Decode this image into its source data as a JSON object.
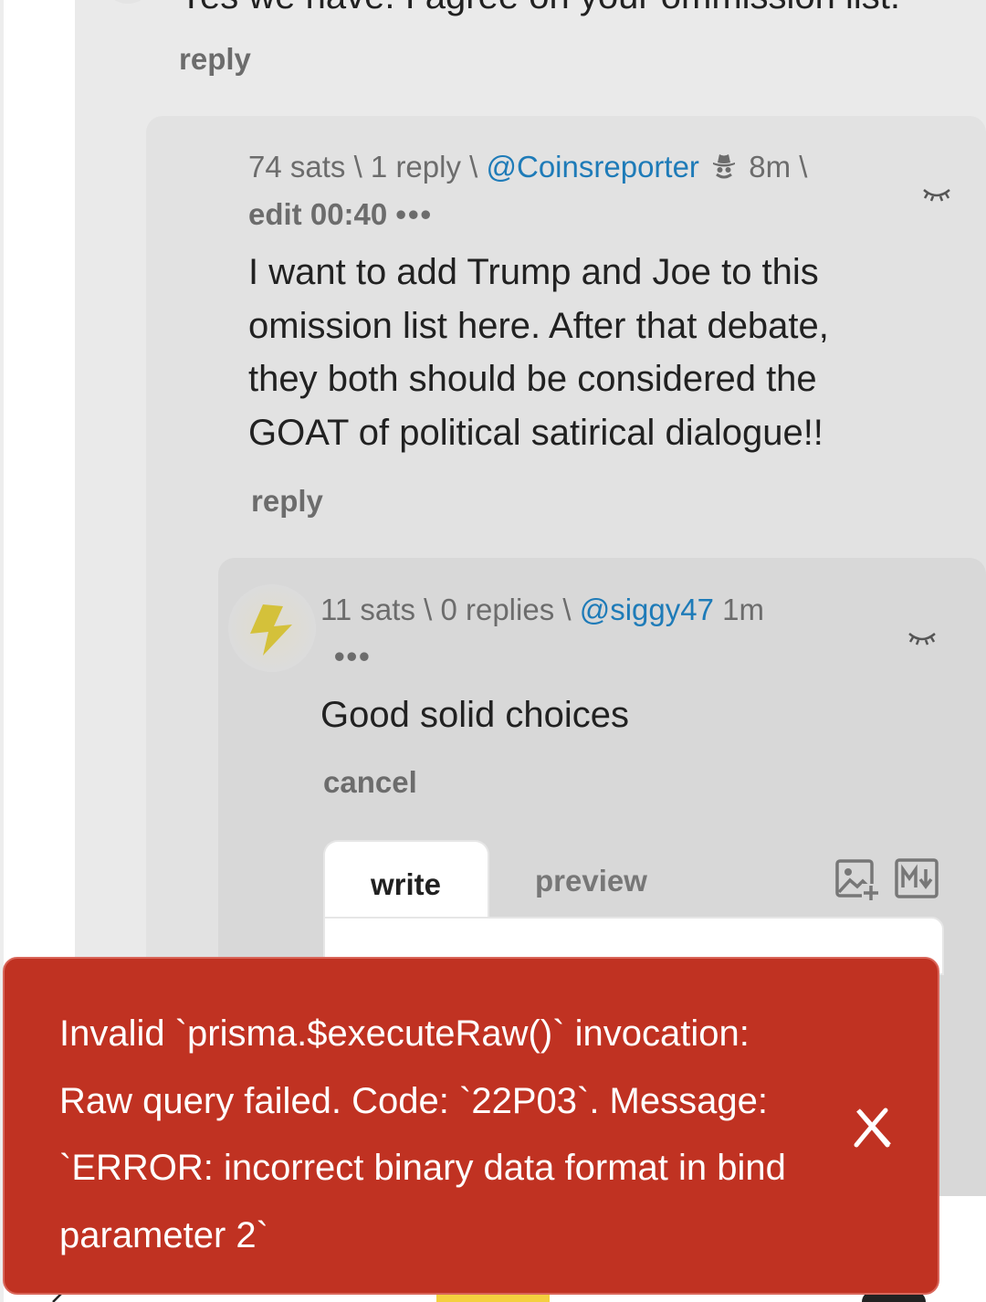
{
  "parent_comment": {
    "snippet": "Yes we have. I agree on your ommission list.",
    "reply_label": "reply"
  },
  "comment_coinsreporter": {
    "sats": "74 sats",
    "replies": "1 reply",
    "user": "@Coinsreporter",
    "time": "8m",
    "sep": "\\",
    "edit_label": "edit 00:40",
    "more": "•••",
    "text": "I want to add Trump and Joe to this omission list here. After that debate, they both should be considered the GOAT of political satirical dialogue!!",
    "reply_label": "reply"
  },
  "comment_siggy": {
    "sats": "11 sats",
    "replies": "0 replies",
    "user": "@siggy47",
    "time": "1m",
    "sep": "\\",
    "more": "•••",
    "text": "Good solid choices",
    "cancel_label": "cancel"
  },
  "editor": {
    "tab_write": "write",
    "tab_preview": "preview"
  },
  "toast": {
    "message": "Invalid `prisma.$executeRaw()` invocation: Raw query failed. Code: `22P03`. Message: `ERROR: incorrect binary data format in bind parameter 2`"
  },
  "colors": {
    "link": "#1e7bb8",
    "toast_bg": "#c03222",
    "bolt": "#d4c13a"
  }
}
